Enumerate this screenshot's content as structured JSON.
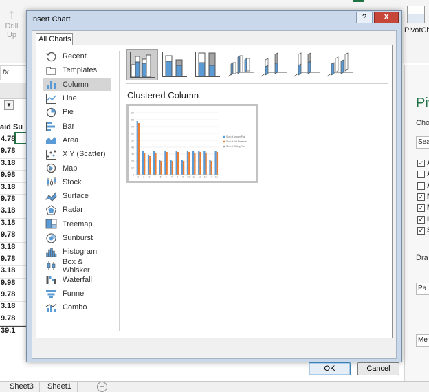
{
  "excel": {
    "ribbon": {
      "drill_up_label_1": "Drill",
      "drill_up_label_2": "Up",
      "pivotchart_label": "PivotCh"
    },
    "fx": "fx",
    "column_header": "aid",
    "column_header_2": "Su",
    "cells": [
      "4.78",
      "9.78",
      "3.18",
      "9.98",
      "3.18",
      "9.78",
      "3.18",
      "3.18",
      "9.78",
      "3.18",
      "9.78",
      "3.18",
      "9.98",
      "9.78",
      "3.18",
      "9.78"
    ],
    "total": "39.1",
    "sheet_tabs": [
      "Sheet3",
      "Sheet1"
    ],
    "add_sheet": "+",
    "pivot_pane": {
      "title": "Piv",
      "choose_text": "Cho",
      "search_text": "Sear",
      "fields": [
        "A",
        "A",
        "A",
        "N",
        "M",
        "I",
        "S"
      ],
      "drag_text": "Dra",
      "filter_box": "Pa",
      "values_box": "Me"
    }
  },
  "dialog": {
    "title": "Insert Chart",
    "help_label": "?",
    "close_label": "X",
    "tab_label": "All Charts",
    "chart_types": [
      {
        "label": "Recent",
        "icon": "recent-icon"
      },
      {
        "label": "Templates",
        "icon": "templates-icon"
      },
      {
        "label": "Column",
        "icon": "column-chart-icon"
      },
      {
        "label": "Line",
        "icon": "line-chart-icon"
      },
      {
        "label": "Pie",
        "icon": "pie-chart-icon"
      },
      {
        "label": "Bar",
        "icon": "bar-chart-icon"
      },
      {
        "label": "Area",
        "icon": "area-chart-icon"
      },
      {
        "label": "X Y (Scatter)",
        "icon": "scatter-chart-icon"
      },
      {
        "label": "Map",
        "icon": "map-chart-icon"
      },
      {
        "label": "Stock",
        "icon": "stock-chart-icon"
      },
      {
        "label": "Surface",
        "icon": "surface-chart-icon"
      },
      {
        "label": "Radar",
        "icon": "radar-chart-icon"
      },
      {
        "label": "Treemap",
        "icon": "treemap-chart-icon"
      },
      {
        "label": "Sunburst",
        "icon": "sunburst-chart-icon"
      },
      {
        "label": "Histogram",
        "icon": "histogram-chart-icon"
      },
      {
        "label": "Box & Whisker",
        "icon": "box-whisker-chart-icon"
      },
      {
        "label": "Waterfall",
        "icon": "waterfall-chart-icon"
      },
      {
        "label": "Funnel",
        "icon": "funnel-chart-icon"
      },
      {
        "label": "Combo",
        "icon": "combo-chart-icon"
      }
    ],
    "selected_type": "Column",
    "subtypes": [
      "clustered-column",
      "stacked-column",
      "100-stacked-column",
      "3d-clustered-column",
      "3d-stacked-column",
      "3d-100-stacked-column",
      "3d-column"
    ],
    "selected_subtype_name": "Clustered Column",
    "ok_label": "OK",
    "cancel_label": "Cancel",
    "colors": {
      "series1": "#5b9bd5",
      "series2": "#ed7d31",
      "series3": "#a5a5a5",
      "close": "#c7463a"
    }
  },
  "chart_data": {
    "type": "bar",
    "categories": [
      "1",
      "2",
      "3",
      "4",
      "5",
      "6",
      "7",
      "8",
      "9",
      "10",
      "11",
      "12",
      "13",
      "14",
      "15"
    ],
    "series": [
      {
        "name": "Sum of AmountPaid",
        "values": [
          78,
          34,
          29,
          34,
          22,
          35,
          22,
          35,
          22,
          35,
          34,
          35,
          34,
          22,
          35
        ]
      },
      {
        "name": "Sum of Net Revenue",
        "values": [
          75,
          32,
          27,
          32,
          20,
          33,
          20,
          33,
          20,
          33,
          32,
          33,
          32,
          20,
          33
        ]
      },
      {
        "name": "Sum of Sliding Fee",
        "values": [
          0,
          0,
          0,
          0,
          0,
          0,
          0,
          0,
          0,
          0,
          0,
          0,
          0,
          0,
          0
        ]
      }
    ],
    "yticks": [
      "90",
      "80",
      "70",
      "60",
      "50",
      "40",
      "30",
      "20",
      "10",
      "0"
    ],
    "ylim": [
      0,
      90
    ],
    "grid": true,
    "legend": "right"
  }
}
